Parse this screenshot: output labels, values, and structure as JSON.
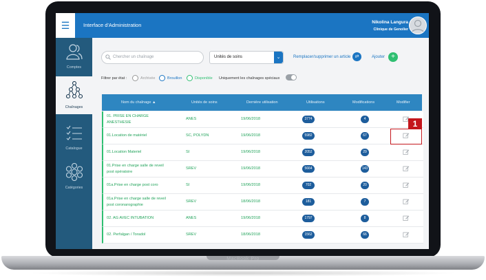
{
  "device": {
    "brand": "MacBook Pro"
  },
  "app": {
    "title": "Interface d'Administration",
    "menu_icon": "hamburger-icon"
  },
  "user": {
    "name": "Nikolina Langura",
    "clinic": "Clinique de Genolier",
    "avatar_icon": "user-avatar-icon"
  },
  "sidebar": {
    "items": [
      {
        "label": "Comptes",
        "icon": "users-icon"
      },
      {
        "label": "Chaînages",
        "icon": "hierarchy-icon",
        "active": true
      },
      {
        "label": "Catalogue",
        "icon": "checklist-icon"
      },
      {
        "label": "Catégories",
        "icon": "cluster-icon"
      }
    ]
  },
  "toolbar": {
    "search_placeholder": "Chercher un chaînage",
    "unit_select_value": "Unités de soins",
    "replace_label": "Remplacer/supprimer un article",
    "add_label": "Ajouter"
  },
  "filters": {
    "label": "Filtrer par état :",
    "archived": "Archivée",
    "draft": "Brouillon",
    "available": "Disponible",
    "special_only": "Uniquement les chaînages spéciaux"
  },
  "table": {
    "headers": {
      "name": "Nom du chaînage ▲",
      "unit": "Unités de soins",
      "last_use": "Dernière utilisation",
      "uses": "Utilisations",
      "modifications": "Modifications",
      "edit": "Modifier"
    },
    "rows": [
      {
        "name1": "01. PRISE EN CHARGE",
        "name2": "ANESTHESIE",
        "unit": "ANES",
        "date": "19/06/2018",
        "uses": "3774",
        "mods": "4"
      },
      {
        "name1": "01.Location de matériel",
        "name2": "",
        "unit": "SC, POLYDN",
        "date": "19/06/2018",
        "uses": "5982",
        "mods": "67"
      },
      {
        "name1": "01.Location Materiel",
        "name2": "",
        "unit": "SI",
        "date": "19/06/2018",
        "uses": "2052",
        "mods": "29"
      },
      {
        "name1": "01.Prise en charge salle de reveil",
        "name2": "post opératoire",
        "unit": "SREV",
        "date": "19/06/2018",
        "uses": "5664",
        "mods": "143"
      },
      {
        "name1": "01a.Prise en charge post coro",
        "name2": "",
        "unit": "SI",
        "date": "19/06/2018",
        "uses": "702",
        "mods": "20"
      },
      {
        "name1": "01a.Prise en charge salle de reveil",
        "name2": "post coronarographie",
        "unit": "SREV",
        "date": "18/06/2018",
        "uses": "181",
        "mods": "7"
      },
      {
        "name1": "02. AG AVEC INTUBATION",
        "name2": "",
        "unit": "ANES",
        "date": "19/06/2018",
        "uses": "1797",
        "mods": "8"
      },
      {
        "name1": "02. Perfalgan / Toradol",
        "name2": "",
        "unit": "SREV",
        "date": "18/06/2018",
        "uses": "1562",
        "mods": "66"
      }
    ]
  },
  "annotation": {
    "number": "1",
    "color": "#c4161c"
  },
  "colors": {
    "primary": "#1b75c2",
    "sidebar": "#235a7d",
    "accent_green": "#2fbf71",
    "table_header": "#2e86c1"
  }
}
